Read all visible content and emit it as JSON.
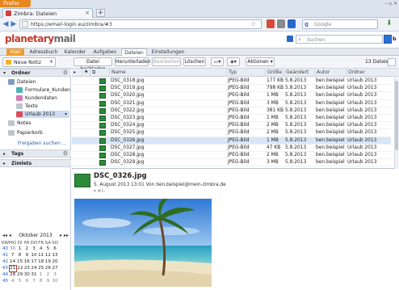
{
  "browser": {
    "menu_button": "Firefox",
    "tab_title": "Zimbra: Dateien",
    "new_tab": "+",
    "url": "https://email-login.eu/zimbra/#3",
    "search_engine": "Google",
    "window_controls": "– ▫ ×"
  },
  "app": {
    "logo_bold": "planetary",
    "logo_light": "mail",
    "search_placeholder": "Suchen",
    "user_initial": "b",
    "tabs": [
      {
        "label": "Mail"
      },
      {
        "label": "Adressbuch"
      },
      {
        "label": "Kalender"
      },
      {
        "label": "Aufgaben"
      },
      {
        "label": "Dateien"
      },
      {
        "label": "Einstellungen"
      }
    ],
    "active_tab": "Dateien"
  },
  "toolbar": {
    "new_label": "Neue Notiz",
    "upload": "Datei hochladen",
    "download": "Herunterladen",
    "edit": "Bearbeiten",
    "delete": "Löschen",
    "actions": "Aktionen",
    "file_count": "13 Dateien"
  },
  "sidebar": {
    "folders_header": "Ordner",
    "folders": [
      {
        "label": "Dateien",
        "color": "#7f9bc0"
      },
      {
        "label": "Formulare_Kunden",
        "color": "#48b5b3"
      },
      {
        "label": "Kundendaten",
        "color": "#d57ab8"
      },
      {
        "label": "Texte",
        "color": "#bfc6cf"
      },
      {
        "label": "Urlaub 2013",
        "color": "#d84e5a"
      },
      {
        "label": "Notes",
        "color": "#bfc6cf"
      },
      {
        "label": "Papierkorb",
        "color": "#bfc6cf"
      }
    ],
    "share_link": "Freigaben suchen ...",
    "tags_header": "Tags",
    "zimlets_header": "Zimlets"
  },
  "calendar": {
    "month": "Oktober 2013",
    "prev": "◂◂ ◂",
    "next": "▸ ▸▸",
    "weekdays": [
      "KW",
      "MO",
      "DI",
      "MI",
      "DO",
      "FR",
      "SA",
      "SO"
    ],
    "weeks": [
      [
        "40",
        "30",
        "1",
        "2",
        "3",
        "4",
        "5",
        "6"
      ],
      [
        "41",
        "7",
        "8",
        "9",
        "10",
        "11",
        "12",
        "13"
      ],
      [
        "42",
        "14",
        "15",
        "16",
        "17",
        "18",
        "19",
        "20"
      ],
      [
        "43",
        "21",
        "22",
        "23",
        "24",
        "25",
        "26",
        "27"
      ],
      [
        "44",
        "28",
        "29",
        "30",
        "31",
        "1",
        "2",
        "3"
      ],
      [
        "45",
        "4",
        "5",
        "6",
        "7",
        "8",
        "9",
        "10"
      ]
    ],
    "today": "21"
  },
  "list": {
    "columns": [
      "Name",
      "Typ",
      "Größe",
      "Geändert",
      "Autor",
      "Ordner"
    ],
    "rows": [
      [
        "DSC_0318.jpg",
        "JPEG-Bild",
        "177 KB",
        "5.8.2013",
        "ben.beispiel",
        "Urlaub 2013"
      ],
      [
        "DSC_0319.jpg",
        "JPEG-Bild",
        "798 KB",
        "5.8.2013",
        "ben.beispiel",
        "Urlaub 2013"
      ],
      [
        "DSC_0320.jpg",
        "JPEG-Bild",
        "1 MB",
        "5.8.2013",
        "ben.beispiel",
        "Urlaub 2013"
      ],
      [
        "DSC_0321.jpg",
        "JPEG-Bild",
        "3 MB",
        "5.8.2013",
        "ben.beispiel",
        "Urlaub 2013"
      ],
      [
        "DSC_0322.jpg",
        "JPEG-Bild",
        "381 KB",
        "5.8.2013",
        "ben.beispiel",
        "Urlaub 2013"
      ],
      [
        "DSC_0323.jpg",
        "JPEG-Bild",
        "1 MB",
        "5.8.2013",
        "ben.beispiel",
        "Urlaub 2013"
      ],
      [
        "DSC_0324.jpg",
        "JPEG-Bild",
        "2 MB",
        "5.8.2013",
        "ben.beispiel",
        "Urlaub 2013"
      ],
      [
        "DSC_0325.jpg",
        "JPEG-Bild",
        "2 MB",
        "5.8.2013",
        "ben.beispiel",
        "Urlaub 2013"
      ],
      [
        "DSC_0326.jpg",
        "JPEG-Bild",
        "1 MB",
        "5.8.2013",
        "ben.beispiel",
        "Urlaub 2013"
      ],
      [
        "DSC_0327.jpg",
        "JPEG-Bild",
        "47 KB",
        "5.8.2013",
        "ben.beispiel",
        "Urlaub 2013"
      ],
      [
        "DSC_0328.jpg",
        "JPEG-Bild",
        "2 MB",
        "5.8.2013",
        "ben.beispiel",
        "Urlaub 2013"
      ],
      [
        "DSC_0329.jpg",
        "JPEG-Bild",
        "3 MB",
        "5.8.2013",
        "ben.beispiel",
        "Urlaub 2013"
      ]
    ],
    "selected_index": 8
  },
  "preview": {
    "title": "DSC_0326.jpg",
    "meta": "5. August 2013 13:01 Von ben.beispiel@mein-zimbra.de",
    "tag": "▾ #1:"
  }
}
